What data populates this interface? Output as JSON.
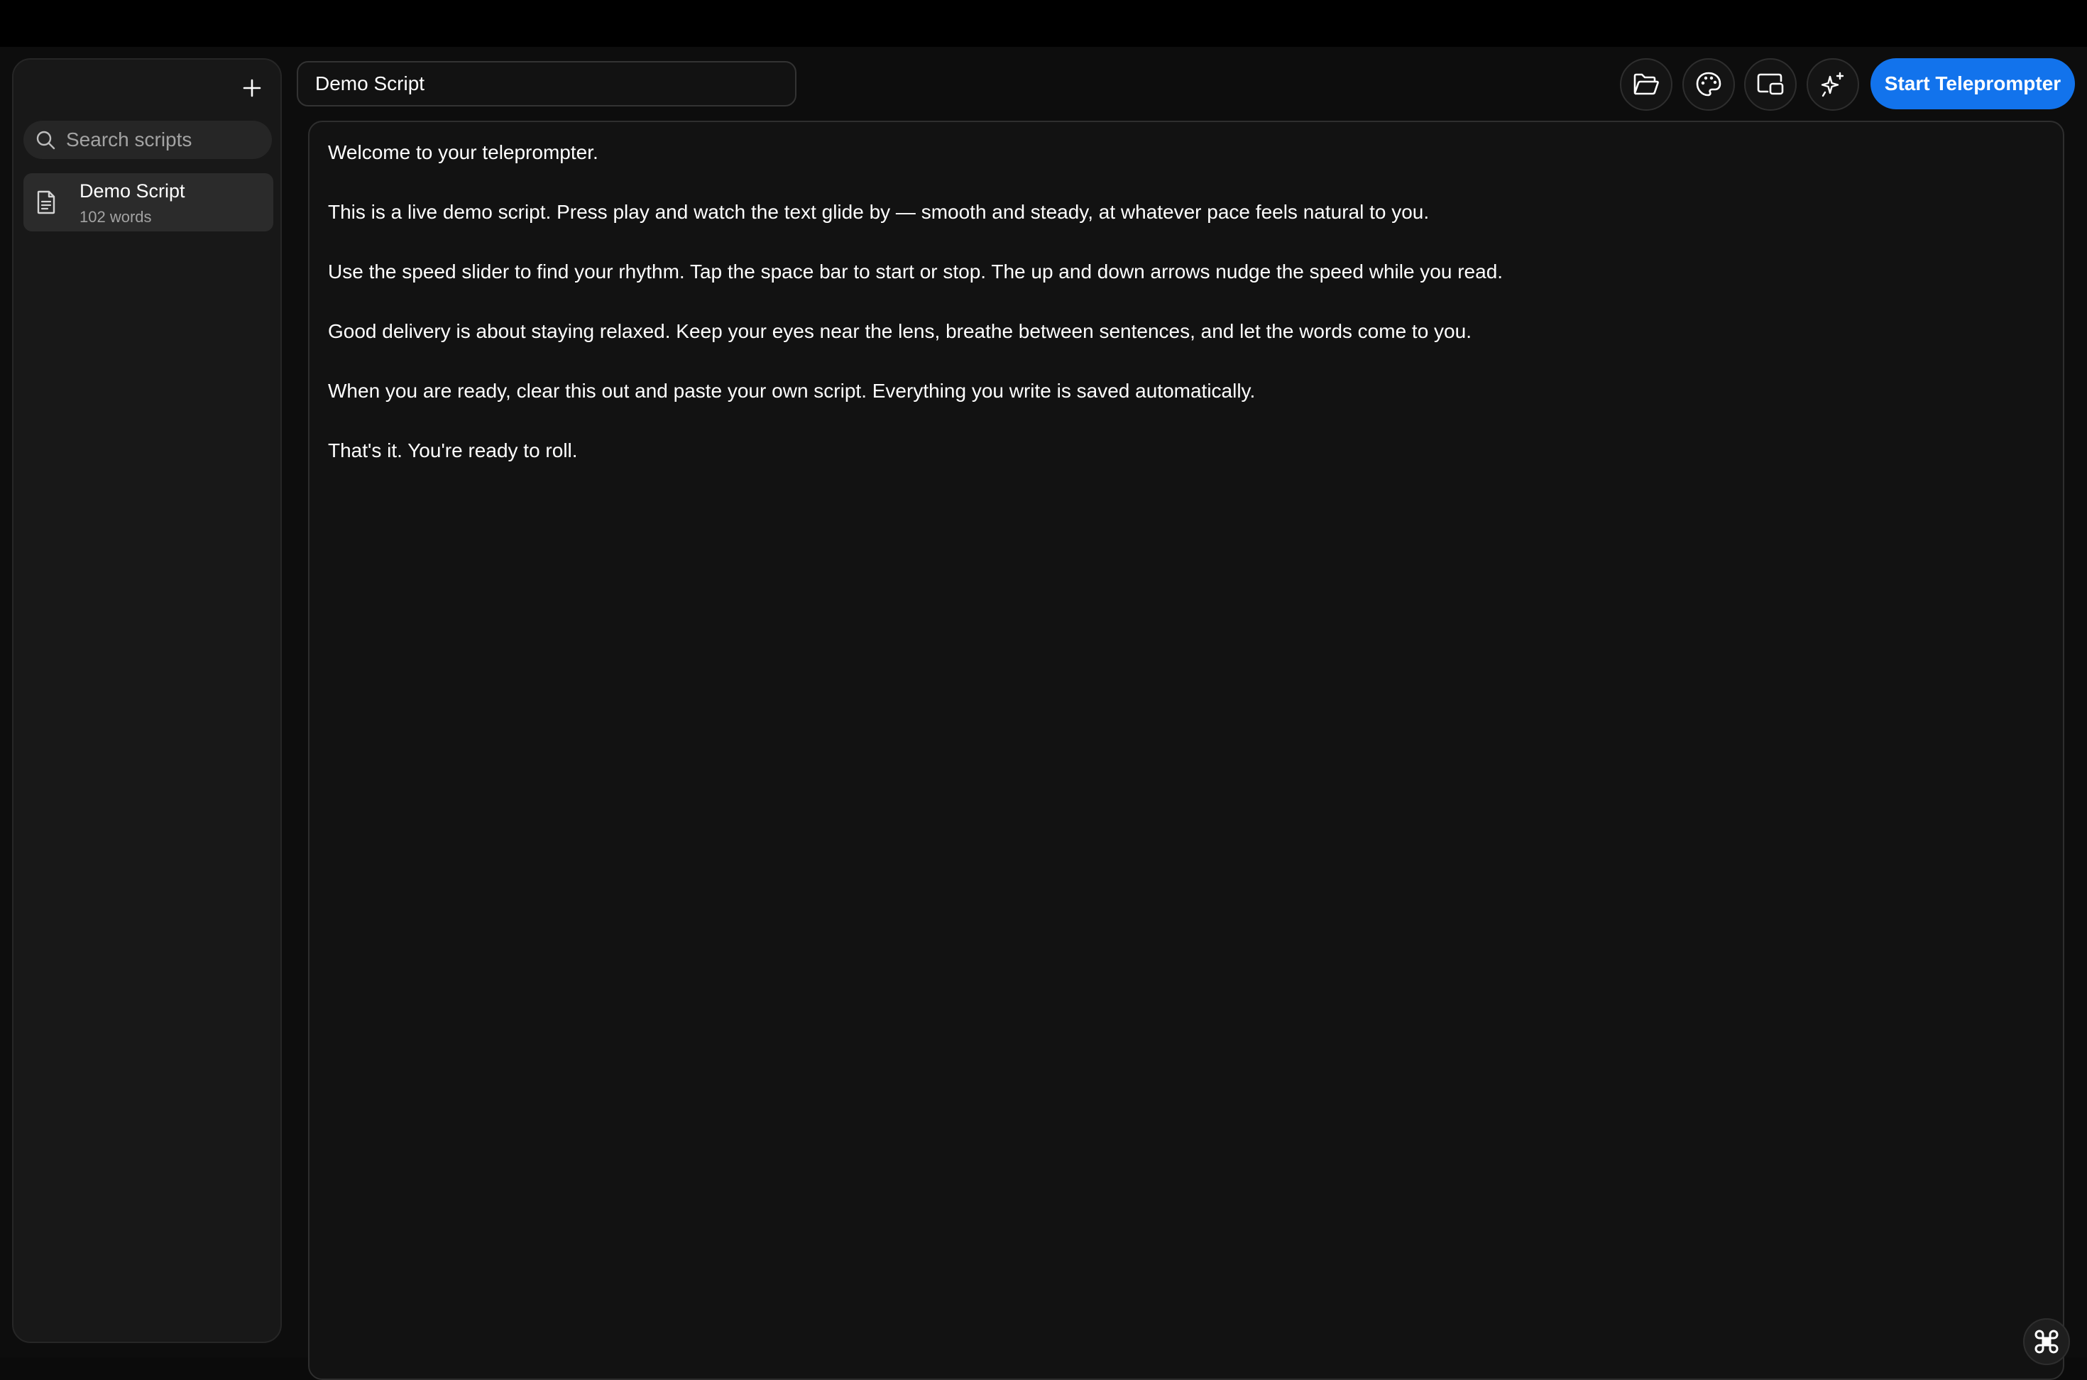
{
  "sidebar": {
    "add_icon": "plus-icon",
    "search": {
      "icon": "search-icon",
      "placeholder": "Search scripts",
      "value": ""
    },
    "scripts": [
      {
        "icon": "document-icon",
        "title": "Demo Script",
        "meta": "102 words"
      }
    ]
  },
  "header": {
    "title_value": "Demo Script",
    "buttons": [
      {
        "icon": "folder-open-icon"
      },
      {
        "icon": "palette-icon"
      },
      {
        "icon": "display-icon"
      },
      {
        "icon": "sparkles-icon"
      }
    ],
    "start_label": "Start Teleprompter"
  },
  "editor": {
    "paragraphs": [
      "Welcome to your teleprompter.",
      "This is a live demo script. Press play and watch the text glide by — smooth and steady, at whatever pace feels natural to you.",
      "Use the speed slider to find your rhythm. Tap the space bar to start or stop. The up and down arrows nudge the speed while you read.",
      "Good delivery is about staying relaxed. Keep your eyes near the lens, breathe between sentences, and let the words come to you.",
      "When you are ready, clear this out and paste your own script. Everything you write is saved automatically.",
      "That's it. You're ready to roll."
    ]
  },
  "corner_button": {
    "icon": "command-icon"
  },
  "colors": {
    "accent": "#1273ec",
    "background": "#0d0d0d",
    "panel": "#181818",
    "editor": "#121212",
    "muted_text": "#a3a3a3"
  }
}
